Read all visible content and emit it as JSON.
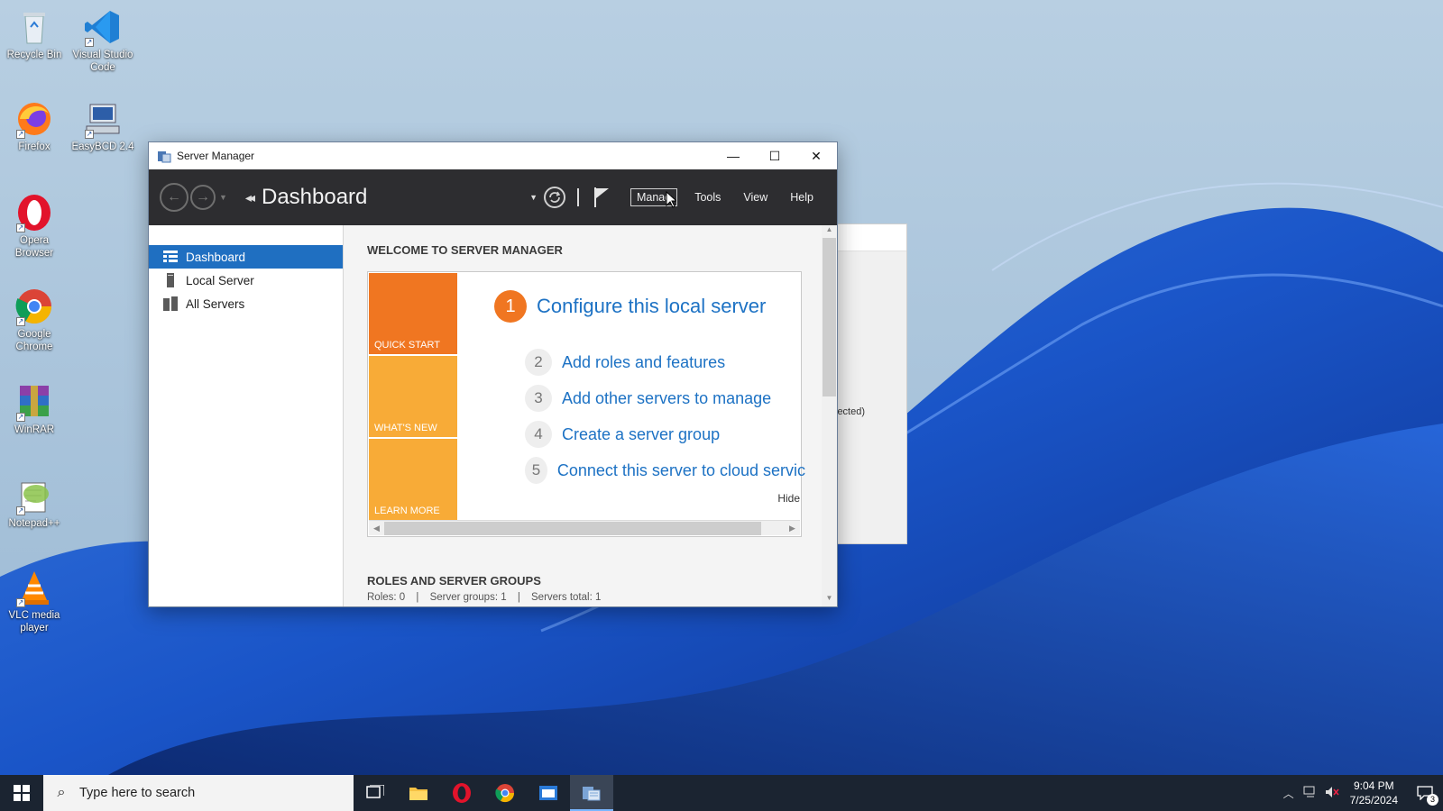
{
  "desktop": {
    "icons": [
      {
        "label": "Recycle Bin",
        "icon": "recycle-bin-icon"
      },
      {
        "label": "Visual Studio Code",
        "icon": "vscode-icon"
      },
      {
        "label": "Firefox",
        "icon": "firefox-icon"
      },
      {
        "label": "EasyBCD 2.4",
        "icon": "easybcd-icon"
      },
      {
        "label": "Opera Browser",
        "icon": "opera-icon"
      },
      {
        "label": "Google Chrome",
        "icon": "chrome-icon"
      },
      {
        "label": "WinRAR",
        "icon": "winrar-icon"
      },
      {
        "label": "Notepad++",
        "icon": "notepadpp-icon"
      },
      {
        "label": "VLC media player",
        "icon": "vlc-icon"
      }
    ]
  },
  "background_window": {
    "partial_text": "lected)"
  },
  "window": {
    "title": "Server Manager",
    "controls": {
      "minimize": "—",
      "maximize": "☐",
      "close": "✕"
    }
  },
  "toolbar": {
    "breadcrumb": "Dashboard",
    "menus": [
      "Manage",
      "Tools",
      "View",
      "Help"
    ],
    "manage_visible": "Manag"
  },
  "sidebar": {
    "items": [
      {
        "label": "Dashboard",
        "icon": "dashboard-icon",
        "selected": true
      },
      {
        "label": "Local Server",
        "icon": "server-icon",
        "selected": false
      },
      {
        "label": "All Servers",
        "icon": "servers-icon",
        "selected": false
      }
    ]
  },
  "main": {
    "welcome_title": "WELCOME TO SERVER MANAGER",
    "tiles": [
      "QUICK START",
      "WHAT'S NEW",
      "LEARN MORE"
    ],
    "main_step": {
      "num": "1",
      "label": "Configure this local server"
    },
    "steps": [
      {
        "num": "2",
        "label": "Add roles and features"
      },
      {
        "num": "3",
        "label": "Add other servers to manage"
      },
      {
        "num": "4",
        "label": "Create a server group"
      },
      {
        "num": "5",
        "label": "Connect this server to cloud servic"
      }
    ],
    "hide_label": "Hide",
    "roles_title": "ROLES AND SERVER GROUPS",
    "roles_summary": {
      "roles": "Roles: 0",
      "groups": "Server groups: 1",
      "total": "Servers total: 1",
      "separator": "|"
    }
  },
  "taskbar": {
    "search_placeholder": "Type here to search",
    "apps": [
      "task-view-icon",
      "file-explorer-icon",
      "opera-icon",
      "chrome-icon",
      "app-window-icon",
      "server-manager-icon"
    ],
    "clock_time": "9:04 PM",
    "clock_date": "7/25/2024",
    "notification_count": "3"
  },
  "colors": {
    "accent_blue": "#1f6fc1",
    "link_blue": "#1d72c4",
    "quick_start_orange": "#f07621",
    "tile_amber": "#f8ab37",
    "toolbar_dark": "#2d2d30",
    "taskbar": "#1b2431"
  }
}
